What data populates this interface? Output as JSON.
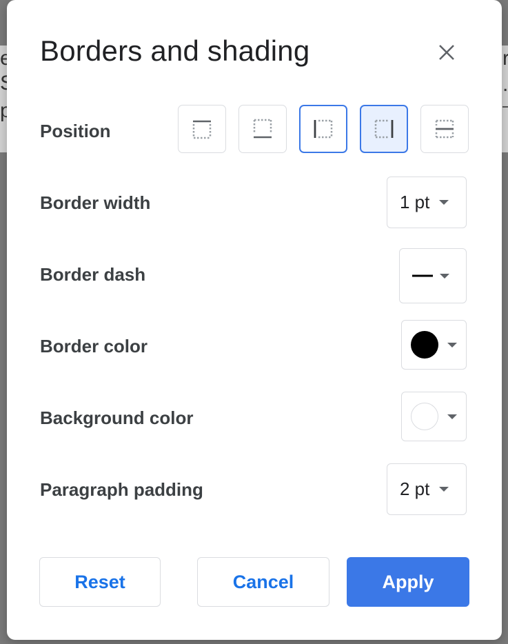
{
  "background": {
    "chars": [
      "e",
      "S",
      "p",
      "r",
      "."
    ]
  },
  "dialog": {
    "title": "Borders and shading",
    "close_icon": "close-icon"
  },
  "position": {
    "label": "Position",
    "options": [
      {
        "name": "top",
        "selected": false
      },
      {
        "name": "bottom",
        "selected": false
      },
      {
        "name": "left",
        "selected": true
      },
      {
        "name": "right",
        "selected": true
      },
      {
        "name": "between",
        "selected": false
      }
    ]
  },
  "border_width": {
    "label": "Border width",
    "value": "1 pt"
  },
  "border_dash": {
    "label": "Border dash",
    "value_icon": "solid-line-icon"
  },
  "border_color": {
    "label": "Border color",
    "color": "#000000"
  },
  "background_color": {
    "label": "Background color",
    "color": "#ffffff"
  },
  "paragraph_padding": {
    "label": "Paragraph padding",
    "value": "2 pt"
  },
  "buttons": {
    "reset": "Reset",
    "cancel": "Cancel",
    "apply": "Apply"
  },
  "colors": {
    "accent": "#3b78e7",
    "link": "#1a73e8",
    "selected_fill": "#e8f0fe"
  }
}
